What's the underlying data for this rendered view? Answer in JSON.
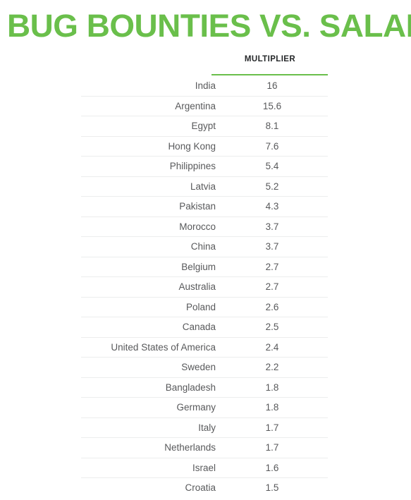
{
  "title": "BUG BOUNTIES VS. SALARY",
  "accent_color": "#6ABF4B",
  "text_color": "#58595b",
  "separator_color": "#eceded",
  "table": {
    "columns": [
      {
        "key": "country",
        "label": ""
      },
      {
        "key": "multiplier",
        "label": "MULTIPLIER"
      }
    ],
    "rows": [
      {
        "country": "India",
        "multiplier": "16"
      },
      {
        "country": "Argentina",
        "multiplier": "15.6"
      },
      {
        "country": "Egypt",
        "multiplier": "8.1"
      },
      {
        "country": "Hong Kong",
        "multiplier": "7.6"
      },
      {
        "country": "Philippines",
        "multiplier": "5.4"
      },
      {
        "country": "Latvia",
        "multiplier": "5.2"
      },
      {
        "country": "Pakistan",
        "multiplier": "4.3"
      },
      {
        "country": "Morocco",
        "multiplier": "3.7"
      },
      {
        "country": "China",
        "multiplier": "3.7"
      },
      {
        "country": "Belgium",
        "multiplier": "2.7"
      },
      {
        "country": "Australia",
        "multiplier": "2.7"
      },
      {
        "country": "Poland",
        "multiplier": "2.6"
      },
      {
        "country": "Canada",
        "multiplier": "2.5"
      },
      {
        "country": "United States of America",
        "multiplier": "2.4"
      },
      {
        "country": "Sweden",
        "multiplier": "2.2"
      },
      {
        "country": "Bangladesh",
        "multiplier": "1.8"
      },
      {
        "country": "Germany",
        "multiplier": "1.8"
      },
      {
        "country": "Italy",
        "multiplier": "1.7"
      },
      {
        "country": "Netherlands",
        "multiplier": "1.7"
      },
      {
        "country": "Israel",
        "multiplier": "1.6"
      },
      {
        "country": "Croatia",
        "multiplier": "1.5"
      }
    ]
  },
  "chart_data": {
    "type": "table",
    "title": "BUG BOUNTIES VS. SALARY",
    "xlabel": "",
    "ylabel": "MULTIPLIER",
    "categories": [
      "India",
      "Argentina",
      "Egypt",
      "Hong Kong",
      "Philippines",
      "Latvia",
      "Pakistan",
      "Morocco",
      "China",
      "Belgium",
      "Australia",
      "Poland",
      "Canada",
      "United States of America",
      "Sweden",
      "Bangladesh",
      "Germany",
      "Italy",
      "Netherlands",
      "Israel",
      "Croatia"
    ],
    "values": [
      16,
      15.6,
      8.1,
      7.6,
      5.4,
      5.2,
      4.3,
      3.7,
      3.7,
      2.7,
      2.7,
      2.6,
      2.5,
      2.4,
      2.2,
      1.8,
      1.8,
      1.7,
      1.7,
      1.6,
      1.5
    ],
    "series": [
      {
        "name": "MULTIPLIER",
        "values": [
          16,
          15.6,
          8.1,
          7.6,
          5.4,
          5.2,
          4.3,
          3.7,
          3.7,
          2.7,
          2.7,
          2.6,
          2.5,
          2.4,
          2.2,
          1.8,
          1.8,
          1.7,
          1.7,
          1.6,
          1.5
        ]
      }
    ],
    "grid": false,
    "legend": "none",
    "sort_order": "descending by multiplier"
  }
}
